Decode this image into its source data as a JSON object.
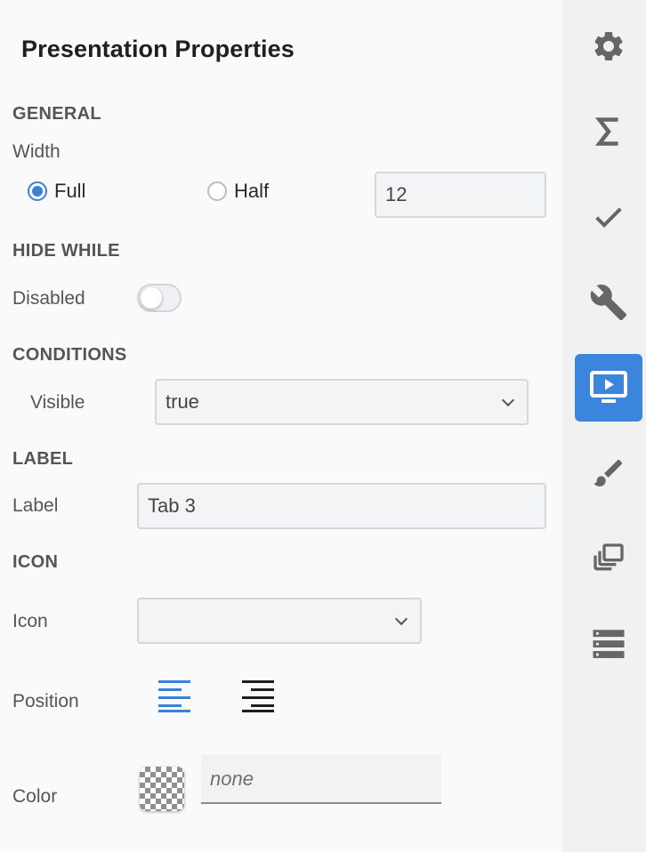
{
  "panel": {
    "title": "Presentation Properties",
    "general": {
      "heading": "GENERAL",
      "width_label": "Width",
      "options": [
        "Full",
        "Half"
      ],
      "selected": "Full",
      "columns_value": "12"
    },
    "hide_while": {
      "heading": "HIDE WHILE",
      "disabled_label": "Disabled",
      "disabled_on": false
    },
    "conditions": {
      "heading": "CONDITIONS",
      "visible_label": "Visible",
      "visible_value": "true"
    },
    "label_section": {
      "heading": "LABEL",
      "label_label": "Label",
      "label_value": "Tab 3"
    },
    "icon_section": {
      "heading": "ICON",
      "icon_label": "Icon",
      "icon_value": "",
      "position_label": "Position",
      "color_label": "Color",
      "color_placeholder": "none"
    }
  },
  "rail": {
    "items": [
      {
        "icon": "gear-icon"
      },
      {
        "icon": "sigma-icon"
      },
      {
        "icon": "checkmark-icon"
      },
      {
        "icon": "wrench-icon"
      },
      {
        "icon": "presentation-icon",
        "active": true
      },
      {
        "icon": "brush-icon"
      },
      {
        "icon": "layers-icon"
      },
      {
        "icon": "list-icon"
      }
    ]
  },
  "colors": {
    "accent": "#3b86dc",
    "active_align": "#3b82d6"
  }
}
